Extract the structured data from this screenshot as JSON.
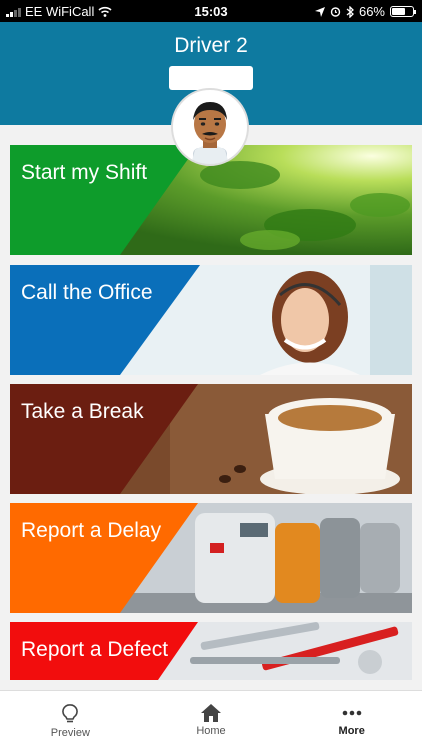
{
  "status_bar": {
    "carrier": "EE WiFiCall",
    "time": "15:03",
    "battery": "66%",
    "battery_level": 0.66
  },
  "header": {
    "title": "Driver 2"
  },
  "tiles": [
    {
      "label": "Start my Shift",
      "color": "#0e9c2b"
    },
    {
      "label": "Call the Office",
      "color": "#0a6fba"
    },
    {
      "label": "Take a Break",
      "color": "#6b1e11"
    },
    {
      "label": "Report a Delay",
      "color": "#ff6a00"
    },
    {
      "label": "Report a Defect",
      "color": "#f20d0d"
    }
  ],
  "bottom_nav": {
    "items": [
      {
        "label": "Preview",
        "icon": "lightbulb-icon"
      },
      {
        "label": "Home",
        "icon": "home-icon"
      },
      {
        "label": "More",
        "icon": "more-dots-icon"
      }
    ]
  },
  "colors": {
    "header_bg": "#0e7aa0",
    "page_bg": "#f2f2f2"
  }
}
